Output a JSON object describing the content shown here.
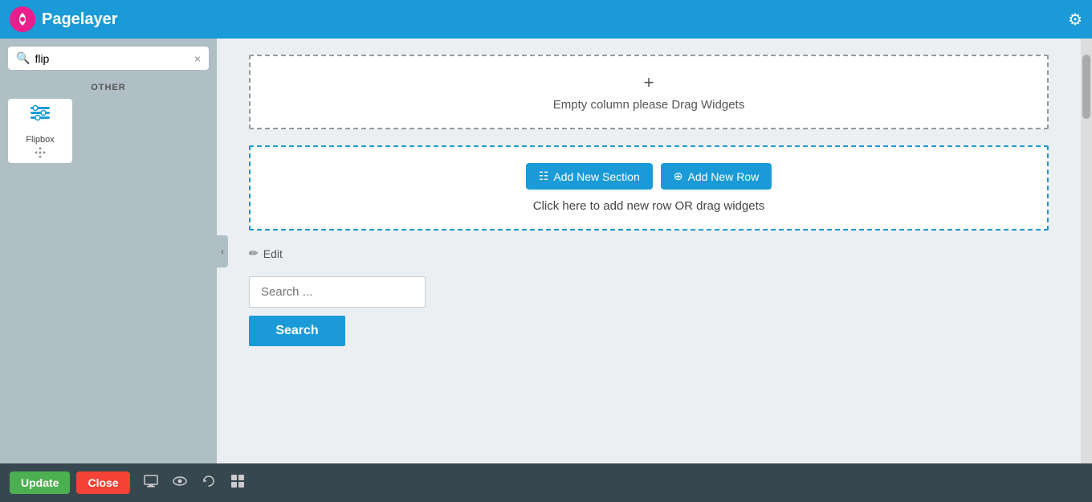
{
  "topbar": {
    "logo_letter": "P",
    "title": "Pagelayer",
    "gear_icon": "⚙"
  },
  "sidebar": {
    "search_placeholder": "flip",
    "clear_btn": "×",
    "section_label": "OTHER",
    "widgets": [
      {
        "id": "flip",
        "icon": "⊞",
        "label": "Flipbox"
      }
    ],
    "collapse_icon": "‹"
  },
  "canvas": {
    "empty_column_plus": "+",
    "empty_column_text": "Empty column please Drag Widgets",
    "add_section_label": "Add New Section",
    "add_row_label": "Add New Row",
    "click_hint": "Click here to add new row OR drag widgets",
    "edit_label": "Edit",
    "search_input_placeholder": "Search ...",
    "search_button_label": "Search"
  },
  "bottom_bar": {
    "update_label": "Update",
    "close_label": "Close",
    "icon_monitor": "🖥",
    "icon_eye": "👁",
    "icon_history": "↺",
    "icon_grid": "⊞"
  }
}
